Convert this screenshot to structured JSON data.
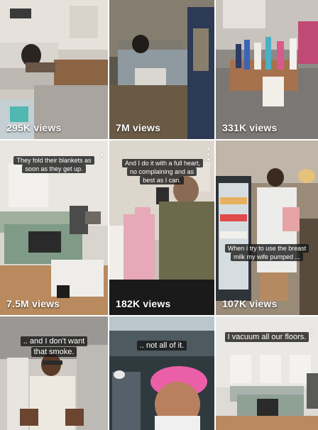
{
  "tiles": [
    {
      "views": "295K views",
      "caption": ""
    },
    {
      "views": "7M views",
      "caption": ""
    },
    {
      "views": "331K views",
      "caption": ""
    },
    {
      "views": "7.5M views",
      "caption": "They fold their blankets as soon as they get up."
    },
    {
      "views": "182K views",
      "caption": "And I do it with a full heart, no complaining and as best as I can."
    },
    {
      "views": "107K views",
      "caption": "When I try to use the breast milk my wife pumped ..."
    },
    {
      "views": "",
      "caption": ".. and I don't want that smoke."
    },
    {
      "views": "",
      "caption": ".. not all of it."
    },
    {
      "views": "",
      "caption": "I vacuum all our floors."
    }
  ],
  "icons": {
    "more": "more-vertical-icon"
  }
}
